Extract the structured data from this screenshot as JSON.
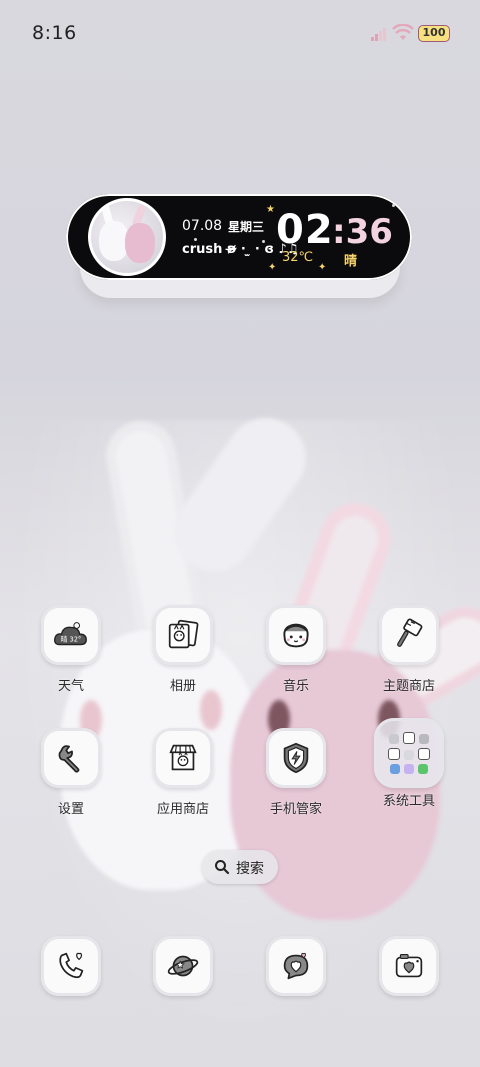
{
  "status_bar": {
    "time": "8:16",
    "battery": "100"
  },
  "widget": {
    "date": "07.08",
    "weekday": "星期三",
    "note": "crush ʚ̴̶̷̷ · ̫ · ɞ ♪♫",
    "hour": "02",
    "minute": ":36",
    "temperature": "32℃",
    "weather": "晴"
  },
  "apps": [
    {
      "label": "天气",
      "icon": "weather-cloud-icon",
      "badge": "晴 32°"
    },
    {
      "label": "相册",
      "icon": "photo-album-icon"
    },
    {
      "label": "音乐",
      "icon": "music-face-icon"
    },
    {
      "label": "主题商店",
      "icon": "paint-brush-icon"
    },
    {
      "label": "设置",
      "icon": "wrench-icon"
    },
    {
      "label": "应用商店",
      "icon": "store-icon"
    },
    {
      "label": "手机管家",
      "icon": "shield-icon"
    },
    {
      "label": "系统工具",
      "icon": "folder-icon"
    }
  ],
  "search": {
    "label": "搜索"
  },
  "dock": [
    {
      "icon": "phone-heart-icon"
    },
    {
      "icon": "planet-icon"
    },
    {
      "icon": "chat-heart-icon"
    },
    {
      "icon": "camera-heart-icon"
    }
  ],
  "colors": {
    "widget_bg": "#0b0b0d",
    "accent_yellow": "#f6d36a",
    "accent_pink": "#f3d3df",
    "battery_fill": "#f6e07f"
  }
}
